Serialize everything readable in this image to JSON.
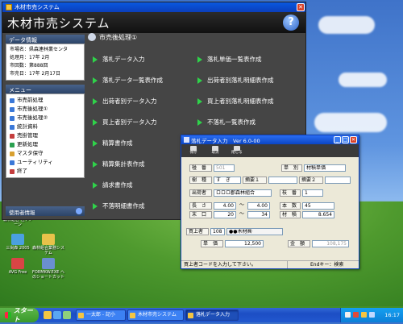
{
  "desktop": {
    "icons": [
      {
        "label": "三尚森 2005",
        "color": "#4aa0e0"
      },
      {
        "label": "森林組合業務システム",
        "color": "#e8c24a"
      },
      {
        "label": "AVG Free",
        "color": "#d84545"
      },
      {
        "label": "FORMKW.EXE へのショートカット",
        "color": "#6a8fd0"
      }
    ],
    "top_label": "森林組合\n社 Pゾーン"
  },
  "app": {
    "window_title": "木材市売システム",
    "header_title": "木材市売システム",
    "help_label": "?",
    "data_info": {
      "heading": "データ情報",
      "lines": [
        "市場名：県森連林業センタ",
        "処理月：17年 2月",
        "市回数：第888回",
        "市売日：17年 2月17日"
      ]
    },
    "menu": {
      "heading": "メニュー",
      "items": [
        {
          "label": "市売前処理",
          "color": "#3a78d8"
        },
        {
          "label": "市売後処理①",
          "color": "#3a78d8"
        },
        {
          "label": "市売後処理②",
          "color": "#3a78d8"
        },
        {
          "label": "統計資料",
          "color": "#3a78d8"
        },
        {
          "label": "売掛管理",
          "color": "#c43d3d"
        },
        {
          "label": "更新処理",
          "color": "#2aa050"
        },
        {
          "label": "マスタ保守",
          "color": "#d8a030"
        },
        {
          "label": "ユーティリティ",
          "color": "#3a78d8"
        },
        {
          "label": "終了",
          "color": "#c43d3d"
        }
      ]
    },
    "user_panel_label": "使用者情報",
    "section_title": "市売後処理①",
    "left_buttons": [
      "落札データ入力",
      "落札データ一覧表作成",
      "出荷者別データ入力",
      "買上者別データ入力",
      "精算書作成",
      "精算集計表作成",
      "請求書作成",
      "不落明細書作成"
    ],
    "right_buttons": [
      "落札単価一覧表作成",
      "出荷者別落札明細表作成",
      "買上者別落札明細表作成",
      "不落札一覧表作成"
    ]
  },
  "dialog": {
    "title": "落札データ入力　Ver 6.0-00",
    "toolbar": [
      "保存",
      "取消",
      "閉じる"
    ],
    "fields": {
      "ban_label": "椪　番",
      "ban_value": "501",
      "tanka_label": "単　別",
      "tanka_value": "材積単価",
      "jushu_label": "樹　種",
      "jushu_value": "す　ぎ",
      "tekiyou1_label": "摘要１",
      "tekiyou1_value": "",
      "tekiyou2_label": "摘要２",
      "tekiyou2_value": "",
      "shukka_label": "出荷者",
      "shukka_value": "ロロロ郡森林組合",
      "ban2_label": "枝　番",
      "ban2_value": "1",
      "length_label": "長　さ",
      "length_from": "4.00",
      "length_to": "4.00",
      "honsu_label": "本　数",
      "honsu_value": "45",
      "kei_label": "末　口",
      "kei_from": "20",
      "kei_to": "34",
      "zaiseki_label": "材　積",
      "zaiseki_value": "8.654",
      "tilde": "～",
      "kaiage_label": "買上者",
      "kaiage_code": "108",
      "kaiage_name": "●●木材㈱",
      "tanka2_label": "単　価",
      "tanka2_value": "12,500",
      "kingaku_label": "金　額",
      "kingaku_value": "108,175"
    },
    "status_left": "買上者コードを入力して下さい。",
    "status_right": "Endキー：検索"
  },
  "taskbar": {
    "start_label": "スタート",
    "tasks": [
      {
        "label": "一太郎 - 記小",
        "active": false
      },
      {
        "label": "木材市売システム",
        "active": false
      },
      {
        "label": "落札データ入力",
        "active": true
      }
    ],
    "clock": "16:17"
  }
}
